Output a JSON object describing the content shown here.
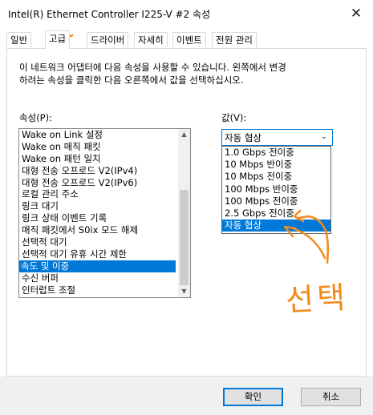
{
  "window": {
    "title": "Intel(R) Ethernet Controller I225-V #2 속성",
    "close_glyph": "✕"
  },
  "tabs": [
    {
      "label": "일반"
    },
    {
      "label": "고급"
    },
    {
      "label": "드라이버"
    },
    {
      "label": "자세히"
    },
    {
      "label": "이벤트"
    },
    {
      "label": "전원 관리"
    }
  ],
  "active_tab": "고급",
  "description": {
    "line1": "이 네트워크 어댑터에 다음 속성을 사용할 수 있습니다. 왼쪽에서 변경",
    "line2": "하려는 속성을 클릭한 다음 오른쪽에서 값을 선택하십시오."
  },
  "property": {
    "label": "속성(P):",
    "items": [
      "Wake on Link 설정",
      "Wake on 매직 패킷",
      "Wake on 패턴 일치",
      "대형 전송 오프로드 V2(IPv4)",
      "대형 전송 오프로드 V2(IPv6)",
      "로컬 관리 주소",
      "링크 대기",
      "링크 상태 이벤트 기록",
      "매직 패킷에서 S0ix 모드 해제",
      "선택적 대기",
      "선택적 대기 유휴 시간 제한",
      "속도 및 이중",
      "수신 버퍼",
      "인터럽트 조절"
    ],
    "selected_index": 11
  },
  "value": {
    "label": "값(V):",
    "selected": "자동 협상",
    "options": [
      "1.0 Gbps 전이중",
      "10 Mbps 반이중",
      "10 Mbps 전이중",
      "100 Mbps 반이중",
      "100 Mbps 전이중",
      "2.5 Gbps 전이중",
      "자동 협상"
    ],
    "highlighted_index": 6
  },
  "buttons": {
    "ok": "확인",
    "cancel": "취소"
  },
  "annotation": {
    "text": "선택",
    "color": "#f28a1e"
  },
  "colors": {
    "selection": "#0078d7",
    "footer_bg": "#f0f0f0"
  }
}
